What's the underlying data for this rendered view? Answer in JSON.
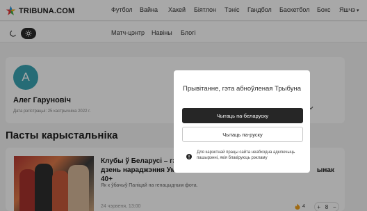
{
  "header": {
    "logo_text": "TRIBUNA.COM",
    "nav": [
      {
        "label": "Футбол"
      },
      {
        "label": "Вайна"
      },
      {
        "label": "Хакей"
      },
      {
        "label": "Біятлон"
      },
      {
        "label": "Тэніс"
      },
      {
        "label": "Гандбол"
      },
      {
        "label": "Баскетбол"
      },
      {
        "label": "Бокс"
      },
      {
        "label": "Яшчэ"
      }
    ]
  },
  "subnav": {
    "items": [
      {
        "label": "Матч-цэнтр"
      },
      {
        "label": "Навіны"
      },
      {
        "label": "Блогі"
      }
    ]
  },
  "profile": {
    "avatar_letter": "А",
    "avatar_color": "#3aa5b3",
    "name": "Алег Гаруновіч",
    "registration": "Дата рэгістрацыі: 25 кастрычніка 2022 г."
  },
  "posts_section": {
    "title": "Пасты карыстальніка"
  },
  "post": {
    "title_left": "Клубы ў Беларусі – гэ",
    "title_left2": "дзень нараджэння Ум",
    "title_right": "ынак",
    "title_line3": "40+",
    "description": "Як к ўбачыў Паліцай на генацыдным фота.",
    "date": "24 чэрвеня, 13:00",
    "likes": "4",
    "votes": "8"
  },
  "modal": {
    "title": "Прывітанне, гэта абноўленая Трыбуна",
    "primary_button": "Чытаць па-беларуску",
    "secondary_button": "Чытаць па-руску",
    "notice": "Для карэктнай працы сайта неабходна адключыць пашырэнні, якія блакіруюць рэкламу"
  },
  "colors": {
    "dark_button": "#262626",
    "accent_avatar": "#3aa5b3"
  }
}
